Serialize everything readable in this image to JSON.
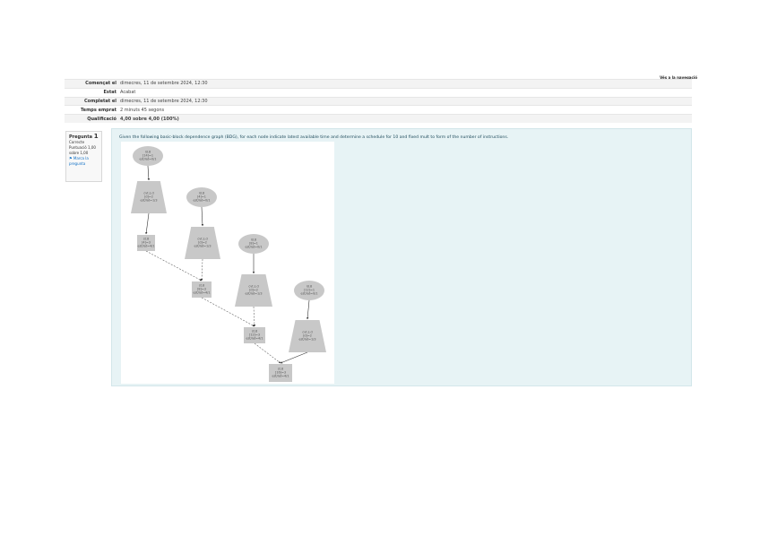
{
  "header": {
    "top_link": "Vés a la navegació"
  },
  "summary": [
    {
      "label": "Començat el",
      "value": "dimecres, 11 de setembre 2024, 12:30"
    },
    {
      "label": "Estat",
      "value": "Acabat"
    },
    {
      "label": "Completat el",
      "value": "dimecres, 11 de setembre 2024, 12:30"
    },
    {
      "label": "Temps emprat",
      "value": "2 minuts 45 segons"
    },
    {
      "label": "Qualificació",
      "value": "4,00 sobre 4,00 (100%)"
    }
  ],
  "question_info": {
    "title": "Pregunta",
    "number": "1",
    "state": "Correcte",
    "mark": "Puntuació 1,00 sobre 1,00",
    "flag": "Marca la pregunta"
  },
  "question": {
    "text": "Given the following basic-block dependence graph (BDG), for each node indicate latest available time and determine a schedule for 10 and fixed mult to form of the number of instructions."
  },
  "dag": {
    "nodes": [
      {
        "id": "n1",
        "shape": "ellipse",
        "lines": [
          "ld.8",
          "[14]=1",
          "est/lat=0/1"
        ]
      },
      {
        "id": "n2",
        "shape": "trapezoid",
        "lines": [
          "cvt.s.d",
          "[d]=2",
          "est/lat=1/3"
        ]
      },
      {
        "id": "n3",
        "shape": "ellipse",
        "lines": [
          "ld.8",
          "[4]=1",
          "est/lat=0/1"
        ]
      },
      {
        "id": "n4",
        "shape": "rect",
        "lines": [
          "st.8",
          "[4]=3",
          "est/lat=4/1"
        ]
      },
      {
        "id": "n5",
        "shape": "trapezoid",
        "lines": [
          "cvt.s.d",
          "[d]=2",
          "est/lat=1/3"
        ]
      },
      {
        "id": "n6",
        "shape": "ellipse",
        "lines": [
          "ld.8",
          "[8]=1",
          "est/lat=0/1"
        ]
      },
      {
        "id": "n7",
        "shape": "rect",
        "lines": [
          "st.8",
          "[8]=3",
          "est/lat=4/1"
        ]
      },
      {
        "id": "n8",
        "shape": "trapezoid",
        "lines": [
          "cvt.s.d",
          "[d]=2",
          "est/lat=1/3"
        ]
      },
      {
        "id": "n9",
        "shape": "ellipse",
        "lines": [
          "ld.8",
          "[12]=1",
          "est/lat=0/1"
        ]
      },
      {
        "id": "n10",
        "shape": "rect",
        "lines": [
          "st.8",
          "[12]=3",
          "est/lat=4/1"
        ]
      },
      {
        "id": "n11",
        "shape": "trapezoid",
        "lines": [
          "cvt.s.d",
          "[d]=2",
          "est/lat=1/3"
        ]
      },
      {
        "id": "n12",
        "shape": "rect",
        "lines": [
          "st.8",
          "[16]=3",
          "est/lat=4/1"
        ]
      }
    ]
  }
}
